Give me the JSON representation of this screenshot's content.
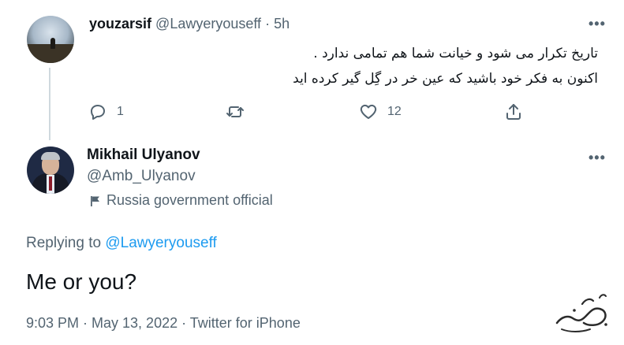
{
  "parent_tweet": {
    "display_name": "youzarsif",
    "handle": "@Lawyeryouseff",
    "separator": " · ",
    "time_ago": "5h",
    "text_line1": "تاریخ تکرار می شود و خیانت شما هم تمامی ندارد .",
    "text_line2": "اکنون به فکر خود باشید که عین خر در گِل گیر کرده اید",
    "reply_count": "1",
    "retweet_count": "",
    "like_count": "12"
  },
  "main_tweet": {
    "display_name": "Mikhail Ulyanov",
    "handle": "@Amb_Ulyanov",
    "account_label": "Russia government official",
    "replying_prefix": "Replying to ",
    "replying_to": "@Lawyeryouseff",
    "text": "Me or you?",
    "timestamp": "9:03 PM · May 13, 2022 · Twitter for iPhone"
  },
  "more_icon_glyph": "•••",
  "colors": {
    "secondary_text": "#536471",
    "link": "#1d9bf0",
    "thread_line": "#cfd9de"
  },
  "icons": [
    "reply-icon",
    "retweet-icon",
    "like-icon",
    "share-icon",
    "more-icon",
    "flag-icon"
  ]
}
